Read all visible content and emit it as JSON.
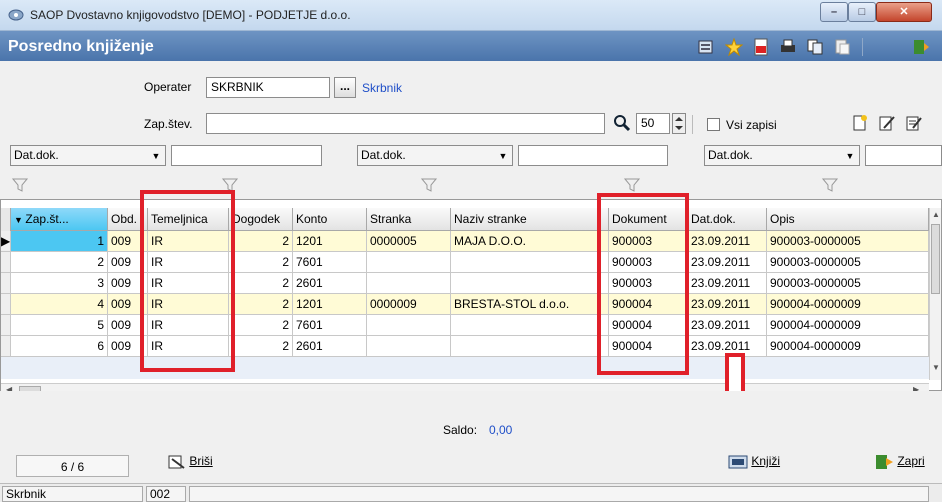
{
  "window": {
    "title": "SAOP Dvostavno knjigovodstvo [DEMO] - PODJETJE d.o.o.",
    "min": "–",
    "max": "□",
    "close": "✕"
  },
  "header": {
    "title": "Posredno knjiženje"
  },
  "form": {
    "operater_label": "Operater",
    "operater_value": "SKRBNIK",
    "operater_button": "...",
    "operater_name": "Skrbnik",
    "zapstev_label": "Zap.štev.",
    "zapstev_value": "",
    "count_value": "50",
    "vsi_zapisi_label": "Vsi zapisi",
    "filters": [
      {
        "field": "Dat.dok.",
        "value": ""
      },
      {
        "field": "Dat.dok.",
        "value": ""
      },
      {
        "field": "Dat.dok.",
        "value": ""
      }
    ]
  },
  "grid": {
    "columns": [
      "Zap.št...",
      "Obd.",
      "Temeljnica",
      "Dogodek",
      "Konto",
      "Stranka",
      "Naziv stranke",
      "Dokument",
      "Dat.dok.",
      "Opis"
    ],
    "rows": [
      [
        "1",
        "009",
        "IR",
        "2",
        "1201",
        "0000005",
        "MAJA D.O.O.",
        "900003",
        "23.09.2011",
        "900003-0000005"
      ],
      [
        "2",
        "009",
        "IR",
        "2",
        "7601",
        "",
        "",
        "900003",
        "23.09.2011",
        "900003-0000005"
      ],
      [
        "3",
        "009",
        "IR",
        "2",
        "2601",
        "",
        "",
        "900003",
        "23.09.2011",
        "900003-0000005"
      ],
      [
        "4",
        "009",
        "IR",
        "2",
        "1201",
        "0000009",
        "BRESTA-STOL d.o.o.",
        "900004",
        "23.09.2011",
        "900004-0000009"
      ],
      [
        "5",
        "009",
        "IR",
        "2",
        "7601",
        "",
        "",
        "900004",
        "23.09.2011",
        "900004-0000009"
      ],
      [
        "6",
        "009",
        "IR",
        "2",
        "2601",
        "",
        "",
        "900004",
        "23.09.2011",
        "900004-0000009"
      ]
    ]
  },
  "footer": {
    "saldo_label": "Saldo:",
    "saldo_value": "0,00",
    "record_counter": "6 / 6",
    "brisi_label": "Briši",
    "knjizi_label": "Knjiži",
    "zapri_label": "Zapri"
  },
  "statusbar": {
    "user": "Skrbnik",
    "code": "002"
  },
  "colors": {
    "header": "#4a74ab",
    "link": "#1f4fc8",
    "highlight_row": "#fffbd6",
    "selected_cell": "#4cc7f2",
    "annotation_red": "#e0202a"
  }
}
